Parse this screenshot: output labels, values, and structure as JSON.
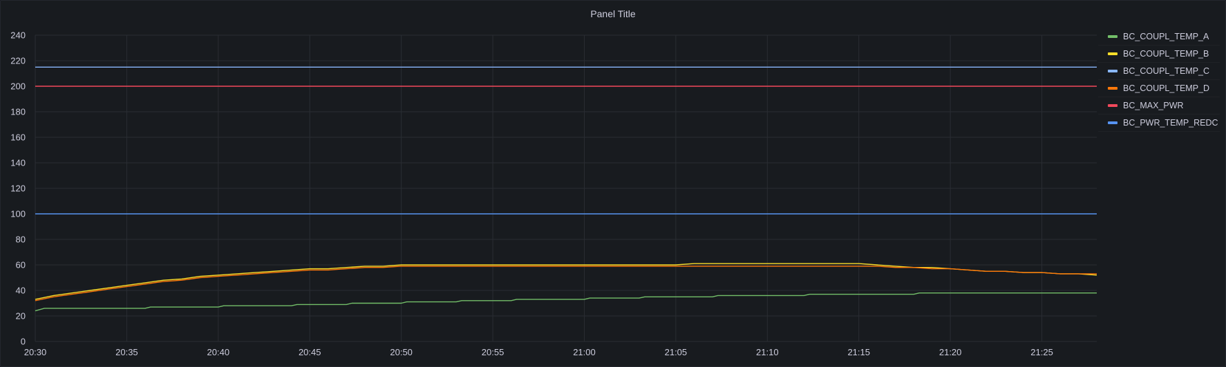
{
  "panel": {
    "title": "Panel Title"
  },
  "chart_data": {
    "type": "line",
    "title": "Panel Title",
    "xlabel": "",
    "ylabel": "",
    "x_ticks": [
      "20:30",
      "20:35",
      "20:40",
      "20:45",
      "20:50",
      "20:55",
      "21:00",
      "21:05",
      "21:10",
      "21:15",
      "21:20",
      "21:25"
    ],
    "x_range": [
      "20:30",
      "21:28"
    ],
    "y_ticks": [
      0,
      20,
      40,
      60,
      80,
      100,
      120,
      140,
      160,
      180,
      200,
      220,
      240
    ],
    "ylim": [
      0,
      240
    ],
    "grid": true,
    "legend_position": "right",
    "series": [
      {
        "name": "BC_COUPL_TEMP_A",
        "color": "#73bf69",
        "points": [
          [
            "20:30",
            24
          ],
          [
            "20:30.5",
            26
          ],
          [
            "20:36",
            26
          ],
          [
            "20:36.3",
            27
          ],
          [
            "20:40",
            27
          ],
          [
            "20:40.3",
            28
          ],
          [
            "20:44",
            28
          ],
          [
            "20:44.3",
            29
          ],
          [
            "20:47",
            29
          ],
          [
            "20:47.3",
            30
          ],
          [
            "20:50",
            30
          ],
          [
            "20:50.3",
            31
          ],
          [
            "20:53",
            31
          ],
          [
            "20:53.3",
            32
          ],
          [
            "20:56",
            32
          ],
          [
            "20:56.3",
            33
          ],
          [
            "21:00",
            33
          ],
          [
            "21:00.3",
            34
          ],
          [
            "21:03",
            34
          ],
          [
            "21:03.3",
            35
          ],
          [
            "21:07",
            35
          ],
          [
            "21:07.3",
            36
          ],
          [
            "21:12",
            36
          ],
          [
            "21:12.3",
            37
          ],
          [
            "21:18",
            37
          ],
          [
            "21:18.3",
            38
          ],
          [
            "21:28",
            38
          ]
        ]
      },
      {
        "name": "BC_COUPL_TEMP_B",
        "color": "#fade2a",
        "points": [
          [
            "20:30",
            33
          ],
          [
            "20:31",
            36
          ],
          [
            "20:32",
            38
          ],
          [
            "20:33",
            40
          ],
          [
            "20:34",
            42
          ],
          [
            "20:35",
            44
          ],
          [
            "20:36",
            46
          ],
          [
            "20:37",
            48
          ],
          [
            "20:38",
            49
          ],
          [
            "20:39",
            51
          ],
          [
            "20:40",
            52
          ],
          [
            "20:41",
            53
          ],
          [
            "20:42",
            54
          ],
          [
            "20:43",
            55
          ],
          [
            "20:44",
            56
          ],
          [
            "20:45",
            57
          ],
          [
            "20:46",
            57
          ],
          [
            "20:47",
            58
          ],
          [
            "20:48",
            59
          ],
          [
            "20:49",
            59
          ],
          [
            "20:50",
            60
          ],
          [
            "20:51",
            60
          ],
          [
            "20:55",
            60
          ],
          [
            "21:00",
            60
          ],
          [
            "21:05",
            60
          ],
          [
            "21:06",
            61
          ],
          [
            "21:10",
            61
          ],
          [
            "21:15",
            61
          ],
          [
            "21:16",
            60
          ],
          [
            "21:17",
            59
          ],
          [
            "21:18",
            58
          ],
          [
            "21:19",
            58
          ],
          [
            "21:20",
            57
          ],
          [
            "21:21",
            56
          ],
          [
            "21:22",
            55
          ],
          [
            "21:23",
            55
          ],
          [
            "21:24",
            54
          ],
          [
            "21:25",
            54
          ],
          [
            "21:26",
            53
          ],
          [
            "21:27",
            53
          ],
          [
            "21:28",
            52
          ]
        ]
      },
      {
        "name": "BC_COUPL_TEMP_C",
        "color": "#8ab8ff",
        "points": [
          [
            "20:30",
            215
          ],
          [
            "21:28",
            215
          ]
        ]
      },
      {
        "name": "BC_COUPL_TEMP_D",
        "color": "#ff780a",
        "points": [
          [
            "20:30",
            32
          ],
          [
            "20:31",
            35
          ],
          [
            "20:32",
            37
          ],
          [
            "20:33",
            39
          ],
          [
            "20:34",
            41
          ],
          [
            "20:35",
            43
          ],
          [
            "20:36",
            45
          ],
          [
            "20:37",
            47
          ],
          [
            "20:38",
            48
          ],
          [
            "20:39",
            50
          ],
          [
            "20:40",
            51
          ],
          [
            "20:41",
            52
          ],
          [
            "20:42",
            53
          ],
          [
            "20:43",
            54
          ],
          [
            "20:44",
            55
          ],
          [
            "20:45",
            56
          ],
          [
            "20:46",
            56
          ],
          [
            "20:47",
            57
          ],
          [
            "20:48",
            58
          ],
          [
            "20:49",
            58
          ],
          [
            "20:50",
            59
          ],
          [
            "20:55",
            59
          ],
          [
            "21:00",
            59
          ],
          [
            "21:05",
            59
          ],
          [
            "21:10",
            59
          ],
          [
            "21:15",
            59
          ],
          [
            "21:16",
            59
          ],
          [
            "21:17",
            58
          ],
          [
            "21:18",
            58
          ],
          [
            "21:19",
            57
          ],
          [
            "21:20",
            57
          ],
          [
            "21:21",
            56
          ],
          [
            "21:22",
            55
          ],
          [
            "21:23",
            55
          ],
          [
            "21:24",
            54
          ],
          [
            "21:25",
            54
          ],
          [
            "21:26",
            53
          ],
          [
            "21:27",
            53
          ],
          [
            "21:28",
            53
          ]
        ]
      },
      {
        "name": "BC_MAX_PWR",
        "color": "#f2495c",
        "points": [
          [
            "20:30",
            200
          ],
          [
            "21:28",
            200
          ]
        ]
      },
      {
        "name": "BC_PWR_TEMP_REDC",
        "color": "#5794f2",
        "points": [
          [
            "20:30",
            100
          ],
          [
            "21:28",
            100
          ]
        ]
      }
    ]
  }
}
